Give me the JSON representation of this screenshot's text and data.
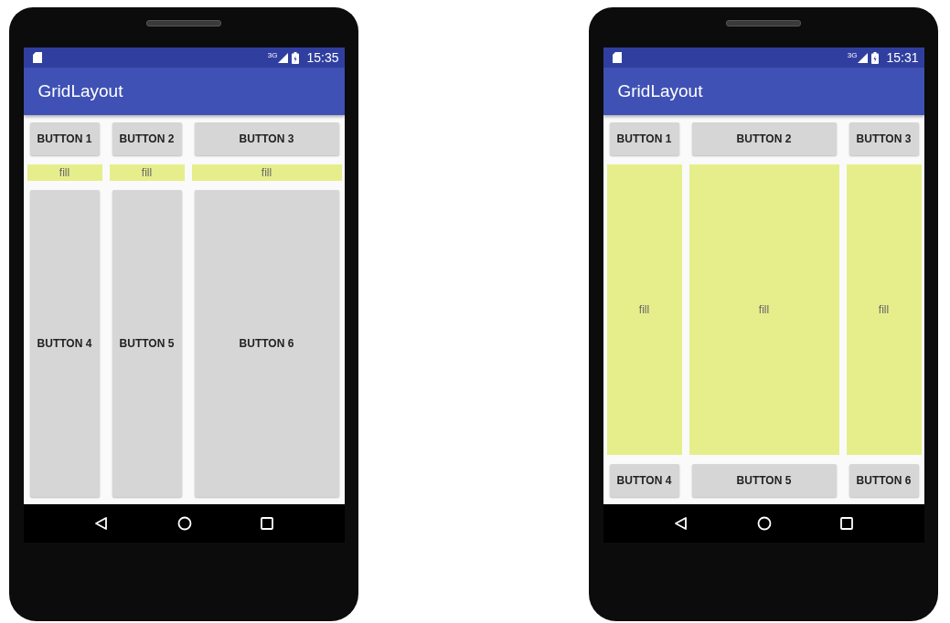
{
  "phones": [
    {
      "status_bar": {
        "network": "3G",
        "time": "15:35"
      },
      "app_bar": {
        "title": "GridLayout"
      },
      "rows": [
        {
          "kind": "buttons",
          "stretch": false,
          "items": [
            "BUTTON 1",
            "BUTTON 2",
            "BUTTON 3"
          ]
        },
        {
          "kind": "fill",
          "stretch": false,
          "items": [
            "fill",
            "fill",
            "fill"
          ]
        },
        {
          "kind": "buttons",
          "stretch": true,
          "items": [
            "BUTTON 4",
            "BUTTON 5",
            "BUTTON 6"
          ]
        }
      ]
    },
    {
      "status_bar": {
        "network": "3G",
        "time": "15:31"
      },
      "app_bar": {
        "title": "GridLayout"
      },
      "rows": [
        {
          "kind": "buttons",
          "stretch": false,
          "items": [
            "BUTTON 1",
            "BUTTON 2",
            "BUTTON 3"
          ]
        },
        {
          "kind": "fill",
          "stretch": true,
          "items": [
            "fill",
            "fill",
            "fill"
          ]
        },
        {
          "kind": "buttons",
          "stretch": false,
          "items": [
            "BUTTON 4",
            "BUTTON 5",
            "BUTTON 6"
          ]
        }
      ]
    }
  ]
}
